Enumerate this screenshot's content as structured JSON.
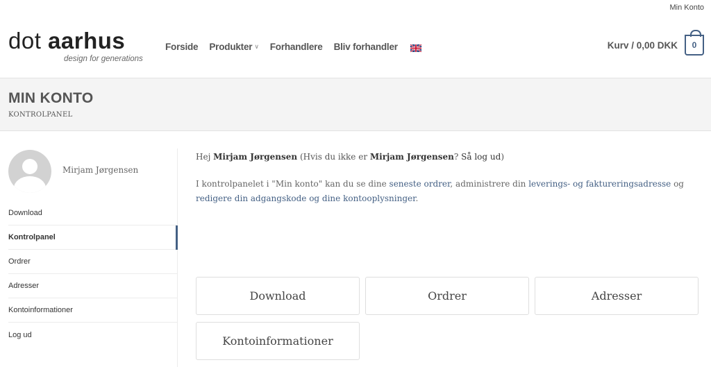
{
  "topbar": {
    "link": "Min Konto"
  },
  "logo": {
    "light": "dot ",
    "bold": "aarhus",
    "tagline": "design for generations"
  },
  "nav": [
    {
      "label": "Forside",
      "has_dropdown": false
    },
    {
      "label": "Produkter",
      "has_dropdown": true
    },
    {
      "label": "Forhandlere",
      "has_dropdown": false
    },
    {
      "label": "Bliv forhandler",
      "has_dropdown": false
    }
  ],
  "language_icon": "uk-flag-icon",
  "cart": {
    "label": "Kurv / 0,00 DKK",
    "count": "0"
  },
  "page": {
    "title": "MIN KONTO",
    "subtitle": "KONTROLPANEL"
  },
  "user": {
    "name": "Mirjam Jørgensen"
  },
  "sidebar": {
    "items": [
      {
        "label": "Download",
        "active": false
      },
      {
        "label": "Kontrolpanel",
        "active": true
      },
      {
        "label": "Ordrer",
        "active": false
      },
      {
        "label": "Adresser",
        "active": false
      },
      {
        "label": "Kontoinformationer",
        "active": false
      },
      {
        "label": "Log ud",
        "active": false
      }
    ]
  },
  "greeting": {
    "hello": "Hej ",
    "name": "Mirjam Jørgensen",
    "paren_open": " (Hvis du ikke er ",
    "name2": "Mirjam Jørgensen",
    "question": "? ",
    "logout": "Så log ud",
    "paren_close": ")"
  },
  "intro": {
    "part1": "I kontrolpanelet i \"Min konto\" kan du se dine ",
    "link1": "seneste ordrer",
    "part2": ", administrere din ",
    "link2": "leverings- og faktureringsadresse",
    "part3": " og ",
    "link3": "redigere din adgangskode og dine kontooplysninger",
    "part4": "."
  },
  "tiles": [
    "Download",
    "Ordrer",
    "Adresser",
    "Kontoinformationer"
  ],
  "colors": {
    "accent": "#446084"
  }
}
